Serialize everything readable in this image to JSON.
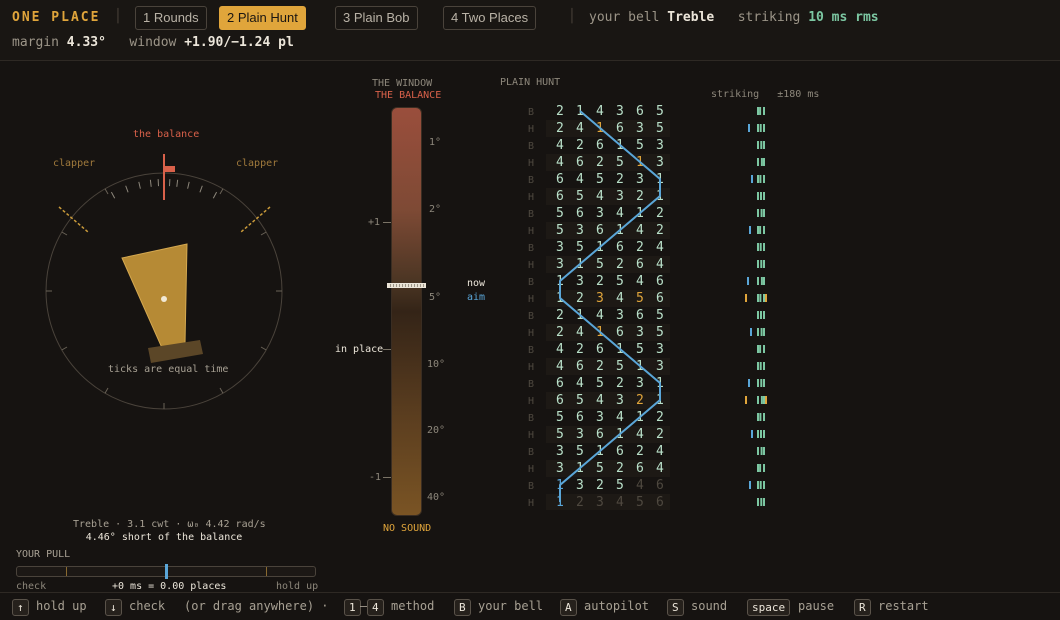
{
  "header": {
    "brand": "ONE PLACE",
    "tabs": [
      {
        "label": "1 Rounds"
      },
      {
        "label": "2 Plain Hunt"
      },
      {
        "label": "3 Plain Bob"
      },
      {
        "label": "4 Two Places"
      }
    ],
    "active_tab": "2 Plain Hunt",
    "your_bell_label": "your bell",
    "your_bell_value": "Treble",
    "striking_label": "striking",
    "striking_value": "10 ms rms",
    "margin_label": "margin",
    "margin_value": "4.33°",
    "window_label": "window",
    "window_value": "+1.90/−1.24 pl"
  },
  "bell": {
    "balance_label": "the balance",
    "clapper_left": "clapper",
    "clapper_right": "clapper",
    "ticks_caption": "ticks are equal time",
    "info_line": "Treble · 3.1 cwt · ω₀ 4.42 rad/s",
    "status_line": "4.46° short of the balance"
  },
  "pull": {
    "title": "YOUR PULL",
    "left_label": "check",
    "right_label": "hold up",
    "readout": "+0 ms = 0.00 places",
    "position": 0.5
  },
  "window_panel": {
    "title1": "THE WINDOW",
    "title2": "THE BALANCE",
    "left_ticks": [
      "+1",
      "in place",
      "-1"
    ],
    "right_ticks": [
      "1°",
      "2°",
      "5°",
      "10°",
      "20°",
      "40°"
    ],
    "now_label": "now",
    "aim_label": "aim",
    "footer": "NO SOUND"
  },
  "hunt": {
    "title": "PLAIN HUNT",
    "striking_title": "striking",
    "striking_range": "±180 ms",
    "rows": [
      {
        "s": "B",
        "n": [
          "2",
          "1",
          "4",
          "3",
          "6",
          "5"
        ],
        "hl": -1,
        "done": true
      },
      {
        "s": "H",
        "n": [
          "2",
          "4",
          "1",
          "6",
          "3",
          "5"
        ],
        "hl": 2,
        "done": true
      },
      {
        "s": "B",
        "n": [
          "4",
          "2",
          "6",
          "1",
          "5",
          "3"
        ],
        "hl": -1,
        "done": true
      },
      {
        "s": "H",
        "n": [
          "4",
          "6",
          "2",
          "5",
          "1",
          "3"
        ],
        "hl": 4,
        "done": true
      },
      {
        "s": "B",
        "n": [
          "6",
          "4",
          "5",
          "2",
          "3",
          "1"
        ],
        "hl": -1,
        "done": true
      },
      {
        "s": "H",
        "n": [
          "6",
          "5",
          "4",
          "3",
          "2",
          "1"
        ],
        "hl": -1,
        "done": true
      },
      {
        "s": "B",
        "n": [
          "5",
          "6",
          "3",
          "4",
          "1",
          "2"
        ],
        "hl": -1,
        "done": true
      },
      {
        "s": "H",
        "n": [
          "5",
          "3",
          "6",
          "1",
          "4",
          "2"
        ],
        "hl": -1,
        "done": true
      },
      {
        "s": "B",
        "n": [
          "3",
          "5",
          "1",
          "6",
          "2",
          "4"
        ],
        "hl": -1,
        "done": true
      },
      {
        "s": "H",
        "n": [
          "3",
          "1",
          "5",
          "2",
          "6",
          "4"
        ],
        "hl": -1,
        "done": true
      },
      {
        "s": "B",
        "n": [
          "1",
          "3",
          "2",
          "5",
          "4",
          "6"
        ],
        "hl": -1,
        "done": true
      },
      {
        "s": "H",
        "n": [
          "1",
          "2",
          "3",
          "4",
          "5",
          "6"
        ],
        "hl": -2,
        "done": true
      },
      {
        "s": "B",
        "n": [
          "2",
          "1",
          "4",
          "3",
          "6",
          "5"
        ],
        "hl": -1,
        "done": true
      },
      {
        "s": "H",
        "n": [
          "2",
          "4",
          "1",
          "6",
          "3",
          "5"
        ],
        "hl": 2,
        "done": true
      },
      {
        "s": "B",
        "n": [
          "4",
          "2",
          "6",
          "1",
          "5",
          "3"
        ],
        "hl": -1,
        "done": true
      },
      {
        "s": "H",
        "n": [
          "4",
          "6",
          "2",
          "5",
          "1",
          "3"
        ],
        "hl": -1,
        "done": true
      },
      {
        "s": "B",
        "n": [
          "6",
          "4",
          "5",
          "2",
          "3",
          "1"
        ],
        "hl": -1,
        "done": true
      },
      {
        "s": "H",
        "n": [
          "6",
          "5",
          "4",
          "3",
          "2",
          "1"
        ],
        "hl": 4,
        "done": true
      },
      {
        "s": "B",
        "n": [
          "5",
          "6",
          "3",
          "4",
          "1",
          "2"
        ],
        "hl": -1,
        "done": true
      },
      {
        "s": "H",
        "n": [
          "5",
          "3",
          "6",
          "1",
          "4",
          "2"
        ],
        "hl": -1,
        "done": true
      },
      {
        "s": "B",
        "n": [
          "3",
          "5",
          "1",
          "6",
          "2",
          "4"
        ],
        "hl": -1,
        "done": true
      },
      {
        "s": "H",
        "n": [
          "3",
          "1",
          "5",
          "2",
          "6",
          "4"
        ],
        "hl": -1,
        "done": true
      },
      {
        "s": "B",
        "n": [
          "1",
          "3",
          "2",
          "5",
          "4",
          "6"
        ],
        "hl": -1,
        "done": "partial4"
      },
      {
        "s": "H",
        "n": [
          "1",
          "2",
          "3",
          "4",
          "5",
          "6"
        ],
        "hl": -1,
        "done": "partial1"
      }
    ]
  },
  "footer": {
    "items": [
      {
        "key": "↑",
        "label": "hold up"
      },
      {
        "key": "↓",
        "label": "check"
      },
      {
        "key": "",
        "label": "(or drag anywhere)  ·"
      },
      {
        "key": "1",
        "label": ""
      },
      {
        "key": "4",
        "label": "method"
      },
      {
        "key": "B",
        "label": "your bell"
      },
      {
        "key": "A",
        "label": "autopilot"
      },
      {
        "key": "S",
        "label": "sound"
      },
      {
        "key": "space",
        "label": "pause"
      },
      {
        "key": "R",
        "label": "restart"
      }
    ],
    "range_dash": "–"
  },
  "colors": {
    "accent": "#e0a53b",
    "treble_line": "#5aa6d8",
    "balance": "#d9614a",
    "striking_good": "#7cc7a2"
  }
}
